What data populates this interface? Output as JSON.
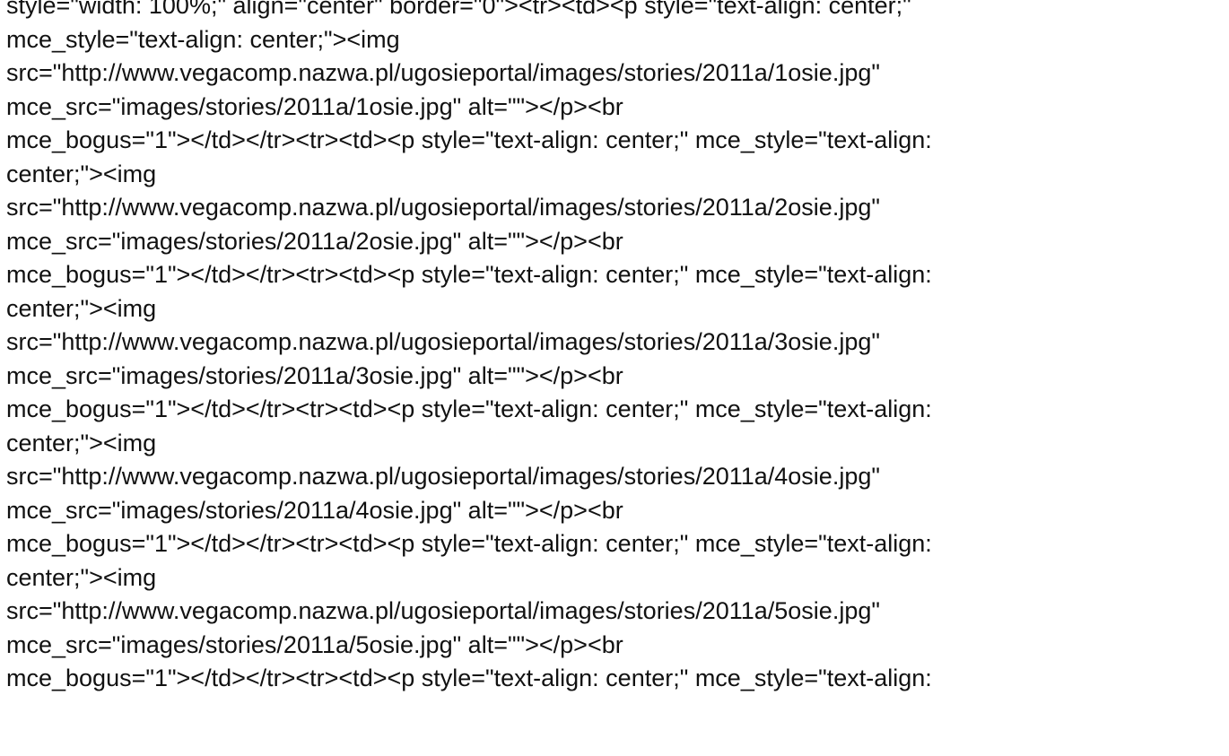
{
  "document": {
    "lines": [
      "style=\"width: 100%;\" align=\"center\" border=\"0\"><tr><td><p style=\"text-align: center;\"",
      "mce_style=\"text-align: center;\"><img",
      "src=\"http://www.vegacomp.nazwa.pl/ugosieportal/images/stories/2011a/1osie.jpg\"",
      "mce_src=\"images/stories/2011a/1osie.jpg\" alt=\"\"></p><br",
      "mce_bogus=\"1\"></td></tr><tr><td><p style=\"text-align: center;\" mce_style=\"text-align:",
      "center;\"><img",
      "src=\"http://www.vegacomp.nazwa.pl/ugosieportal/images/stories/2011a/2osie.jpg\"",
      "mce_src=\"images/stories/2011a/2osie.jpg\" alt=\"\"></p><br",
      "mce_bogus=\"1\"></td></tr><tr><td><p style=\"text-align: center;\" mce_style=\"text-align:",
      "center;\"><img",
      "src=\"http://www.vegacomp.nazwa.pl/ugosieportal/images/stories/2011a/3osie.jpg\"",
      "mce_src=\"images/stories/2011a/3osie.jpg\" alt=\"\"></p><br",
      "mce_bogus=\"1\"></td></tr><tr><td><p style=\"text-align: center;\" mce_style=\"text-align:",
      "center;\"><img",
      "src=\"http://www.vegacomp.nazwa.pl/ugosieportal/images/stories/2011a/4osie.jpg\"",
      "mce_src=\"images/stories/2011a/4osie.jpg\" alt=\"\"></p><br",
      "mce_bogus=\"1\"></td></tr><tr><td><p style=\"text-align: center;\" mce_style=\"text-align:",
      "center;\"><img",
      "src=\"http://www.vegacomp.nazwa.pl/ugosieportal/images/stories/2011a/5osie.jpg\"",
      "mce_src=\"images/stories/2011a/5osie.jpg\" alt=\"\"></p><br",
      "mce_bogus=\"1\"></td></tr><tr><td><p style=\"text-align: center;\" mce_style=\"text-align:"
    ]
  }
}
